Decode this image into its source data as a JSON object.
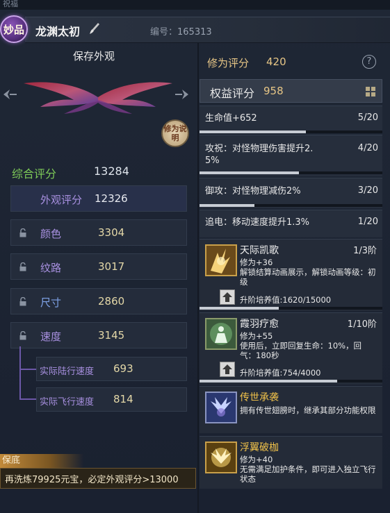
{
  "window": {
    "title": "祝福"
  },
  "header": {
    "badge_label": "妙品",
    "character_name": "龙渊太初",
    "serial_label": "编号：",
    "serial_number": "165313"
  },
  "appearance": {
    "save_title": "保存外观",
    "help_button_label": "修为说明",
    "total_label": "综合评分",
    "total_value": "13284",
    "stats": [
      {
        "label": "外观评分",
        "value": "12326",
        "locked": false
      },
      {
        "label": "颜色",
        "value": "3304",
        "locked": true
      },
      {
        "label": "纹路",
        "value": "3017",
        "locked": true
      },
      {
        "label": "尺寸",
        "value": "2860",
        "locked": true
      },
      {
        "label": "速度",
        "value": "3145",
        "locked": true
      }
    ],
    "speed_details": [
      {
        "label": "实际陆行速度",
        "value": "693"
      },
      {
        "label": "实际飞行速度",
        "value": "814"
      }
    ],
    "notice": {
      "tag": "保底",
      "text": "再洗炼79925元宝，必定外观评分>13000"
    }
  },
  "cultivation": {
    "label": "修为评分",
    "value": "420",
    "help_icon": "question-circle-icon"
  },
  "rights": {
    "label": "权益评分",
    "value": "958",
    "grid_icon": "grid-icon",
    "attributes": [
      {
        "label": "生命值+652",
        "count": "5/20",
        "progress": 0.25
      },
      {
        "label": "攻祝：对怪物理伤害提升2.5%",
        "label_line1": "攻祝：对怪物理伤害提升2.",
        "label_line2": "5%",
        "count": "4/20",
        "progress": 0.2
      },
      {
        "label": "御攻：对怪物理减伤2%",
        "count": "3/20",
        "progress": 0.15
      },
      {
        "label": "追电：移动速度提升1.3%",
        "count": "1/20",
        "progress": 0.05
      }
    ],
    "skills": [
      {
        "name": "天际凯歌",
        "tier": "1/3阶",
        "desc_line1": "修为+36",
        "desc_line2": "解锁结算动画展示，解锁动画等级：初级",
        "upgrade": "升阶培养值:1620/15000",
        "progress": 0.108,
        "icon": "lightning-wing-icon"
      },
      {
        "name": "霞羽疗愈",
        "tier": "1/10阶",
        "desc_line1": "修为+55",
        "desc_line2": "使用后，立即回复生命：10%，回气：180秒",
        "upgrade": "升阶培养值:754/4000",
        "progress": 0.1885,
        "icon": "healing-figure-icon"
      },
      {
        "name": "传世承袭",
        "desc_line1": "拥有传世翅膀时，继承其部分功能权限",
        "icon": "crystal-wing-icon"
      },
      {
        "name": "浮翼破枷",
        "desc_line1": "修为+40",
        "desc_line2": "无需满足加护条件，即可进入独立飞行状态",
        "icon": "golden-wing-icon"
      }
    ]
  }
}
